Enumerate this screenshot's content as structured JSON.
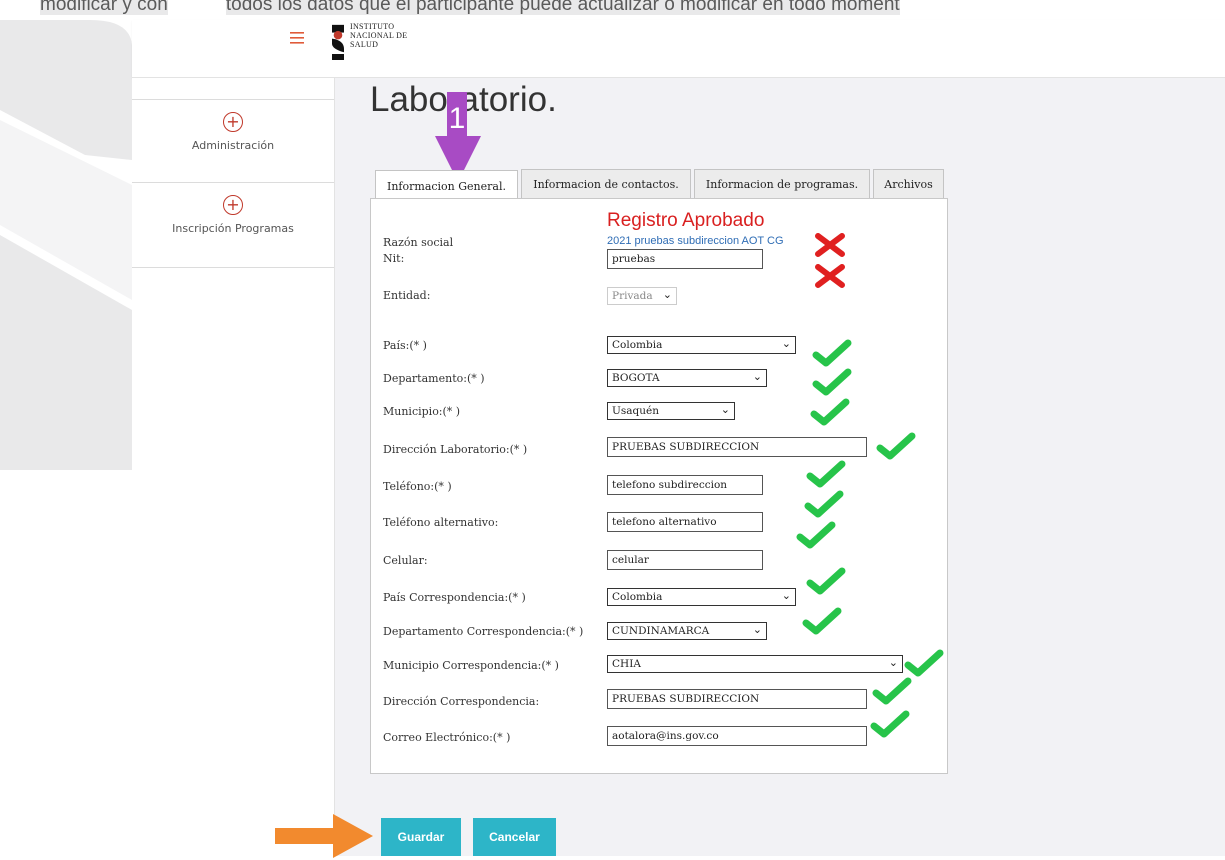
{
  "doc_text": {
    "part1": "modificar y con",
    "part2": "todos los datos que el participante puede actualizar o modificar en todo moment"
  },
  "header": {
    "logo_lines": [
      "INSTITUTO",
      "NACIONAL DE",
      "SALUD"
    ],
    "menu_icon": "hamburger-icon"
  },
  "sidebar": {
    "items": [
      {
        "label": "Administración",
        "icon": "plus-circle-icon"
      },
      {
        "label": "Inscripción Programas",
        "icon": "plus-circle-icon"
      }
    ]
  },
  "page": {
    "title": "Laboratorio.",
    "annotation_step": "1"
  },
  "tabs": [
    {
      "label": "Informacion General.",
      "active": true
    },
    {
      "label": "Informacion de contactos.",
      "active": false
    },
    {
      "label": "Informacion de programas.",
      "active": false
    },
    {
      "label": "Archivos",
      "active": false
    }
  ],
  "form": {
    "status": "Registro Aprobado",
    "razon_social": {
      "label": "Razón social",
      "value": "2021 pruebas subdireccion AOT CG"
    },
    "nit": {
      "label": "Nit:",
      "value": "pruebas"
    },
    "entidad": {
      "label": "Entidad:",
      "value": "Privada"
    },
    "pais": {
      "label": "País:(* )",
      "value": "Colombia"
    },
    "departamento": {
      "label": "Departamento:(* )",
      "value": "BOGOTA"
    },
    "municipio": {
      "label": "Municipio:(* )",
      "value": "Usaquén"
    },
    "direccion_lab": {
      "label": "Dirección Laboratorio:(* )",
      "value": "PRUEBAS SUBDIRECCION"
    },
    "telefono": {
      "label": "Teléfono:(* )",
      "value": "telefono subdireccion"
    },
    "telefono_alt": {
      "label": "Teléfono alternativo:",
      "value": "telefono alternativo"
    },
    "celular": {
      "label": "Celular:",
      "value": "celular"
    },
    "pais_corr": {
      "label": "País Correspondencia:(* )",
      "value": "Colombia"
    },
    "depto_corr": {
      "label": "Departamento Correspondencia:(* )",
      "value": "CUNDINAMARCA"
    },
    "municipio_corr": {
      "label": "Municipio Correspondencia:(* )",
      "value": "CHIA"
    },
    "direccion_corr": {
      "label": "Dirección Correspondencia:",
      "value": "PRUEBAS SUBDIRECCION"
    },
    "correo": {
      "label": "Correo Electrónico:(* )",
      "value": "aotalora@ins.gov.co"
    }
  },
  "buttons": {
    "save": "Guardar",
    "cancel": "Cancelar"
  },
  "colors": {
    "accent": "#2db5c8",
    "status": "#d92020",
    "editable_mark": "#27c44a",
    "locked_mark": "#e02020",
    "annotation_purple": "#a84bc4",
    "annotation_orange": "#f28a2e"
  }
}
